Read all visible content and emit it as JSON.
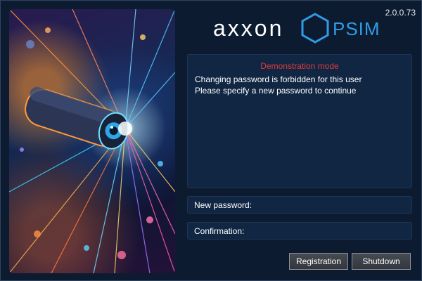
{
  "app": {
    "version": "2.0.0.73",
    "logo_word": "axxon",
    "logo_product": "PSIM"
  },
  "message": {
    "title": "Demonstration mode",
    "lines": [
      "Changing password is forbidden for this user",
      "Please specify a new password to continue"
    ]
  },
  "form": {
    "new_password_label": "New password:",
    "new_password_value": "",
    "confirmation_label": "Confirmation:",
    "confirmation_value": ""
  },
  "buttons": {
    "registration": "Registration",
    "shutdown": "Shutdown"
  },
  "colors": {
    "background": "#0c1b30",
    "panel": "#102642",
    "accent": "#2f9ce6",
    "warning": "#e23a3a"
  },
  "splash_image": {
    "icon": "security-camera-icon"
  }
}
